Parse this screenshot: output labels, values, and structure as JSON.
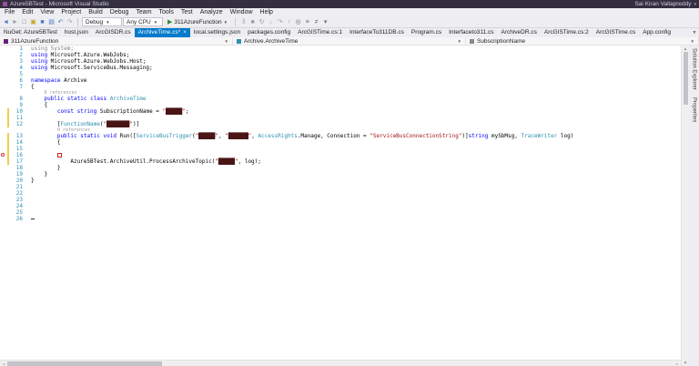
{
  "window": {
    "title": "Azure5BTest - Microsoft Visual Studio",
    "user_name": "Sai Kiran Vallapreddy"
  },
  "menu": {
    "items": [
      "File",
      "Edit",
      "View",
      "Project",
      "Build",
      "Debug",
      "Team",
      "Tools",
      "Test",
      "Analyze",
      "Window",
      "Help"
    ]
  },
  "toolbar": {
    "left_icons": [
      {
        "name": "navigate-back-icon",
        "glyph": "◄",
        "color": "#4a76c9"
      },
      {
        "name": "navigate-forward-icon",
        "glyph": "►",
        "color": "#9aa0a6"
      },
      {
        "name": "new-file-icon",
        "glyph": "□",
        "color": "#6a6a75"
      },
      {
        "name": "open-file-icon",
        "glyph": "▣",
        "color": "#c9a227"
      },
      {
        "name": "save-icon",
        "glyph": "■",
        "color": "#4a76c9"
      },
      {
        "name": "save-all-icon",
        "glyph": "▤",
        "color": "#4a76c9"
      },
      {
        "name": "undo-icon",
        "glyph": "↶",
        "color": "#4a76c9"
      },
      {
        "name": "redo-icon",
        "glyph": "↷",
        "color": "#9aa0a6"
      }
    ],
    "configuration_combo": "Debug",
    "platform_combo": "Any CPU",
    "run_button_label": "311AzureFunction",
    "right_icons": [
      {
        "name": "break-all-icon",
        "glyph": "‖",
        "color": "#9aa0a6"
      },
      {
        "name": "stop-debug-icon",
        "glyph": "■",
        "color": "#9aa0a6"
      },
      {
        "name": "restart-icon",
        "glyph": "↻",
        "color": "#9aa0a6"
      },
      {
        "name": "step-into-icon",
        "glyph": "↓",
        "color": "#9aa0a6"
      },
      {
        "name": "step-over-icon",
        "glyph": "↷",
        "color": "#9aa0a6"
      },
      {
        "name": "step-out-icon",
        "glyph": "↑",
        "color": "#9aa0a6"
      },
      {
        "name": "find-in-files-icon",
        "glyph": "◎",
        "color": "#6a6a75"
      },
      {
        "name": "comment-icon",
        "glyph": "≡",
        "color": "#6a6a75"
      },
      {
        "name": "uncomment-icon",
        "glyph": "≠",
        "color": "#6a6a75"
      },
      {
        "name": "bookmark-icon",
        "glyph": "▾",
        "color": "#6a6a75"
      }
    ]
  },
  "tabs": [
    {
      "label": "NuGet: Azure5BTest"
    },
    {
      "label": "host.json"
    },
    {
      "label": "ArcGISDR.cs"
    },
    {
      "label": "ArchiveTime.cs*",
      "active": true,
      "close": "×"
    },
    {
      "label": "local.settings.json"
    },
    {
      "label": "packages.config"
    },
    {
      "label": "ArcGISTime.cs:1"
    },
    {
      "label": "InterfaceTo311DB.cs"
    },
    {
      "label": "Program.cs"
    },
    {
      "label": "Interfaceto311.cs"
    },
    {
      "label": "ArchiveDR.cs"
    },
    {
      "label": "ArcGISTime.cs:2"
    },
    {
      "label": "ArcGISTime.cs"
    },
    {
      "label": "App.config"
    }
  ],
  "navbar": {
    "project": "311AzureFunction",
    "type": "Archive.ArchiveTime",
    "member": "SubscriptionName"
  },
  "side_panel": {
    "tabs": [
      "Solution Explorer",
      "Properties"
    ]
  },
  "colors": {
    "accent": "#007acc",
    "keyword": "#0000ff",
    "type_name": "#2b91af",
    "string": "#a31515",
    "line_number": "#2b91af",
    "title_bar": "#332f41",
    "change_bar": "#f2c94c",
    "breakpoint": "#d13438",
    "redaction": "#4a1515"
  },
  "editor": {
    "rows": [
      {
        "n": 1,
        "segs": [
          [
            "using System;",
            "gy"
          ]
        ]
      },
      {
        "n": 2,
        "segs": [
          [
            "using",
            "kw"
          ],
          [
            " Microsoft.Azure.WebJobs;",
            "pl"
          ]
        ]
      },
      {
        "n": 3,
        "segs": [
          [
            "using",
            "kw"
          ],
          [
            " Microsoft.Azure.WebJobs.Host;",
            "pl"
          ]
        ]
      },
      {
        "n": 4,
        "segs": [
          [
            "using",
            "kw"
          ],
          [
            " Microsoft.ServiceBus.Messaging;",
            "pl"
          ]
        ]
      },
      {
        "n": 5,
        "segs": []
      },
      {
        "n": 6,
        "segs": [
          [
            "namespace",
            "kw"
          ],
          [
            " Archive",
            "pl"
          ]
        ]
      },
      {
        "n": 7,
        "segs": [
          [
            "{",
            "pl"
          ]
        ]
      },
      {
        "lens": "0 references",
        "pad": 4
      },
      {
        "n": 8,
        "segs": [
          [
            "    ",
            "pl"
          ],
          [
            "public",
            "kw"
          ],
          [
            " ",
            "pl"
          ],
          [
            "static",
            "kw"
          ],
          [
            " ",
            "pl"
          ],
          [
            "class",
            "kw"
          ],
          [
            " ",
            "pl"
          ],
          [
            "ArchiveTime",
            "ty"
          ]
        ]
      },
      {
        "n": 9,
        "segs": [
          [
            "    {",
            "pl"
          ]
        ]
      },
      {
        "n": 10,
        "chg": true,
        "segs": [
          [
            "        ",
            "pl"
          ],
          [
            "const",
            "kw"
          ],
          [
            " ",
            "pl"
          ],
          [
            "string",
            "kw"
          ],
          [
            " SubscriptionName = ",
            "pl"
          ],
          [
            "\"",
            "st"
          ],
          [
            "█████",
            "rb"
          ],
          [
            "\"",
            "st"
          ],
          [
            ";",
            "pl"
          ]
        ]
      },
      {
        "n": 11,
        "chg": true,
        "segs": []
      },
      {
        "n": 12,
        "chg": true,
        "segs": [
          [
            "        [",
            "pl"
          ],
          [
            "FunctionName",
            "ty"
          ],
          [
            "(",
            "pl"
          ],
          [
            "\"",
            "st"
          ],
          [
            "███████",
            "rb"
          ],
          [
            "\"",
            "st"
          ],
          [
            ")]",
            "pl"
          ]
        ]
      },
      {
        "lens": "0 references",
        "pad": 8
      },
      {
        "n": 13,
        "chg": true,
        "segs": [
          [
            "        ",
            "pl"
          ],
          [
            "public",
            "kw"
          ],
          [
            " ",
            "pl"
          ],
          [
            "static",
            "kw"
          ],
          [
            " ",
            "pl"
          ],
          [
            "void",
            "kw"
          ],
          [
            " Run([",
            "pl"
          ],
          [
            "ServiceBusTrigger",
            "ty"
          ],
          [
            "(",
            "pl"
          ],
          [
            "\"",
            "st"
          ],
          [
            "█████",
            "rb"
          ],
          [
            "\"",
            "st"
          ],
          [
            ", ",
            "pl"
          ],
          [
            "\"",
            "st"
          ],
          [
            "██████",
            "rb"
          ],
          [
            "\"",
            "st"
          ],
          [
            ", ",
            "pl"
          ],
          [
            "AccessRights",
            "ty"
          ],
          [
            ".Manage, Connection = ",
            "pl"
          ],
          [
            "\"ServiceBusConnectionString\"",
            "st"
          ],
          [
            ")]",
            "pl"
          ],
          [
            "string",
            "kw"
          ],
          [
            " mySbMsg, ",
            "pl"
          ],
          [
            "TraceWriter",
            "ty"
          ],
          [
            " log)",
            "pl"
          ]
        ]
      },
      {
        "n": 14,
        "chg": true,
        "segs": [
          [
            "        {",
            "pl"
          ]
        ]
      },
      {
        "n": 15,
        "chg": true,
        "segs": []
      },
      {
        "n": 16,
        "chg": true,
        "bp": true,
        "box": true,
        "segs": [
          [
            "        ",
            "pl"
          ]
        ]
      },
      {
        "n": 17,
        "chg": true,
        "segs": [
          [
            "            Azure5BTest.ArchiveUtil.ProcessArchiveTopic(",
            "pl"
          ],
          [
            "\"",
            "st"
          ],
          [
            "█████",
            "rb"
          ],
          [
            "\"",
            "st"
          ],
          [
            ", log);",
            "pl"
          ]
        ]
      },
      {
        "n": 18,
        "segs": [
          [
            "        }",
            "pl"
          ]
        ]
      },
      {
        "n": 19,
        "segs": [
          [
            "    }",
            "pl"
          ]
        ]
      },
      {
        "n": 20,
        "segs": [
          [
            "}",
            "pl"
          ]
        ]
      },
      {
        "n": 21,
        "segs": []
      },
      {
        "n": 22,
        "segs": []
      },
      {
        "n": 23,
        "segs": []
      },
      {
        "n": 24,
        "segs": []
      },
      {
        "n": 25,
        "segs": []
      },
      {
        "n": 26,
        "caret": true,
        "segs": []
      }
    ]
  }
}
